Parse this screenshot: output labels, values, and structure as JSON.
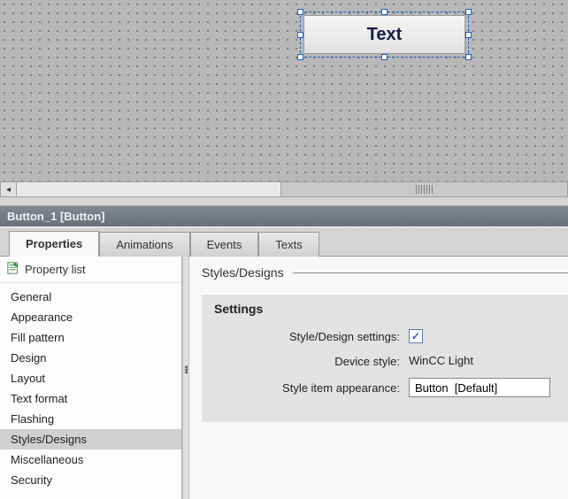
{
  "canvas": {
    "button_label": "Text"
  },
  "object_title": "Button_1 [Button]",
  "tabs": [
    {
      "label": "Properties",
      "active": true
    },
    {
      "label": "Animations",
      "active": false
    },
    {
      "label": "Events",
      "active": false
    },
    {
      "label": "Texts",
      "active": false
    }
  ],
  "sidebar": {
    "header": "Property list",
    "items": [
      "General",
      "Appearance",
      "Fill pattern",
      "Design",
      "Layout",
      "Text format",
      "Flashing",
      "Styles/Designs",
      "Miscellaneous",
      "Security"
    ],
    "selected_index": 7
  },
  "pane": {
    "title": "Styles/Designs",
    "group_title": "Settings",
    "rows": {
      "style_settings_label": "Style/Design settings:",
      "style_settings_checked": true,
      "device_style_label": "Device style:",
      "device_style_value": "WinCC Light",
      "style_item_label": "Style item appearance:",
      "style_item_value": "Button  [Default]"
    }
  }
}
